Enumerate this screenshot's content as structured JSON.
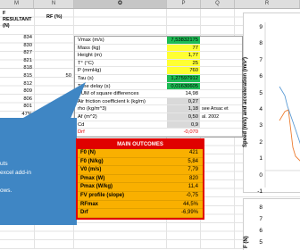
{
  "columns": [
    "M",
    "N",
    "O",
    "P",
    "Q",
    "R"
  ],
  "left_headers": {
    "m": "F RESULTANT (N)",
    "n": "RF (%)"
  },
  "col_m_values": [
    "834",
    "830",
    "827",
    "821",
    "818",
    "815",
    "812",
    "809",
    "806",
    "801",
    "47%",
    "46%",
    "45%",
    "44%",
    "43%",
    "41%",
    "40%",
    "40%"
  ],
  "col_n_values": [
    "",
    "",
    "",
    "",
    "",
    "50",
    "",
    "",
    "",
    "",
    "47%",
    "46%",
    "45%",
    "44%",
    "43%",
    "41%",
    "40%",
    "40%"
  ],
  "input_rows": [
    {
      "label": "Vmax (m/s)",
      "value": "7,53832175",
      "fill": "green",
      "red": false,
      "note": ""
    },
    {
      "label": "Mass (kg)",
      "value": "77",
      "fill": "yellow",
      "red": false,
      "note": ""
    },
    {
      "label": "Height (m)",
      "value": "1,77",
      "fill": "yellow",
      "red": false,
      "note": ""
    },
    {
      "label": "T° (°C)",
      "value": "25",
      "fill": "yellow",
      "red": false,
      "note": ""
    },
    {
      "label": "P (mmHg)",
      "value": "760",
      "fill": "yellow",
      "red": false,
      "note": ""
    },
    {
      "label": "Tau (s)",
      "value": "1,27597912",
      "fill": "green",
      "red": false,
      "note": ""
    },
    {
      "label": "Time delay (s)",
      "value": "0,01630605",
      "fill": "green",
      "red": false,
      "note": ""
    },
    {
      "label": "SUM of square differences",
      "value": "14,98",
      "fill": "none",
      "red": false,
      "note": ""
    },
    {
      "label": "Air friction coefficient k (kg/m)",
      "value": "0,27",
      "fill": "gray",
      "red": false,
      "note": ""
    },
    {
      "label": "rho (kg/m^3)",
      "value": "1,18",
      "fill": "gray",
      "red": false,
      "note": "see Arsac et"
    },
    {
      "label": "Af (m^2)",
      "value": "0,50",
      "fill": "gray",
      "red": false,
      "note": "al. 2002"
    },
    {
      "label": "Cd",
      "value": "0,9",
      "fill": "gray",
      "red": false,
      "note": ""
    },
    {
      "label": "Drf",
      "value": "-0,070",
      "fill": "none",
      "red": true,
      "note": ""
    }
  ],
  "outcomes": {
    "title": "MAIN OUTCOMES",
    "rows": [
      {
        "label": "F0 (N)",
        "value": "421"
      },
      {
        "label": "F0 (N/kg)",
        "value": "5,84"
      },
      {
        "label": "V0 (m/s)",
        "value": "7,79"
      },
      {
        "label": "Pmax (W)",
        "value": "820"
      },
      {
        "label": "Pmax (W/kg)",
        "value": "11,4"
      },
      {
        "label": "FV profile (slope)",
        "value": "-0,75"
      },
      {
        "label": "RFmax",
        "value": "44,5%"
      },
      {
        "label": "Drf",
        "value": "-6,99%"
      }
    ]
  },
  "callout": {
    "lines": [
      "uts",
      "excel add-in",
      "ows."
    ]
  },
  "chart_top": {
    "ylabel": "Speed (m/s) and acceleration (m/s²)",
    "ticks": [
      "9",
      "8",
      "7",
      "6",
      "5",
      "4",
      "3",
      "2",
      "1",
      "0",
      "-1"
    ],
    "colors": {
      "speed": "#ed7d31",
      "acceleration": "#5b9bd5"
    }
  },
  "chart_bottom": {
    "ylabel": "F (N)",
    "ticks": [
      "8",
      "7",
      "6",
      "5"
    ]
  }
}
